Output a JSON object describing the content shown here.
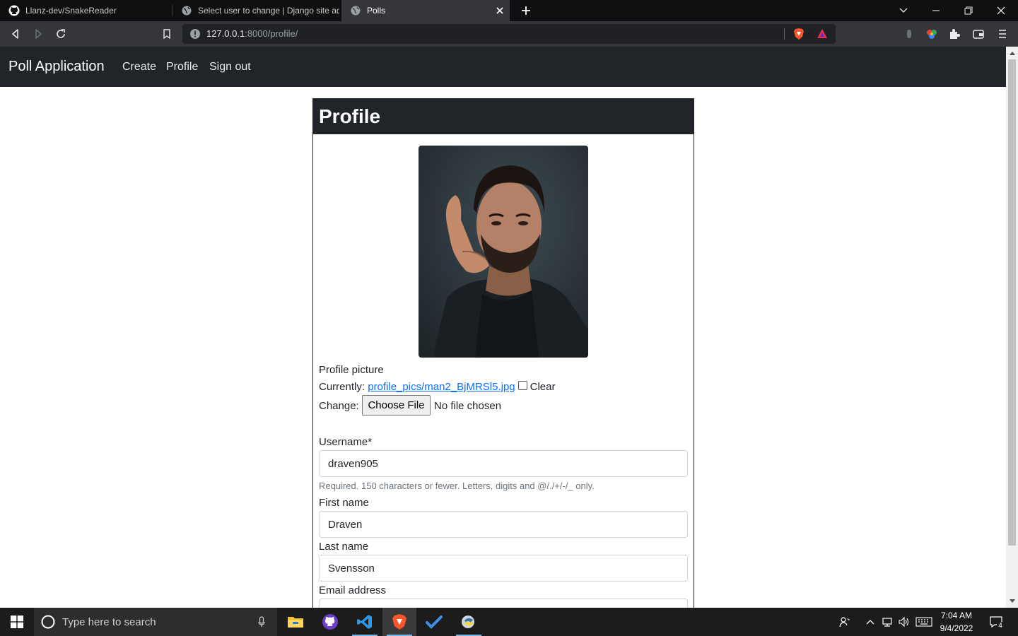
{
  "browser": {
    "tabs": [
      {
        "title": "Llanz-dev/SnakeReader",
        "icon": "github-icon"
      },
      {
        "title": "Select user to change | Django site admin",
        "icon": "globe-icon"
      },
      {
        "title": "Polls",
        "icon": "globe-icon",
        "active": true
      }
    ],
    "url_host": "127.0.0.1",
    "url_rest": ":8000/profile/"
  },
  "navbar": {
    "brand": "Poll Application",
    "links": [
      "Create",
      "Profile",
      "Sign out"
    ]
  },
  "profile": {
    "title": "Profile",
    "picture_label": "Profile picture",
    "currently_label": "Currently:",
    "current_file": "profile_pics/man2_BjMRSl5.jpg",
    "clear_label": "Clear",
    "change_label": "Change:",
    "choose_file_button": "Choose File",
    "no_file_text": "No file chosen",
    "username_label": "Username*",
    "username_value": "draven905",
    "username_help": "Required. 150 characters or fewer. Letters, digits and @/./+/-/_ only.",
    "first_name_label": "First name",
    "first_name_value": "Draven",
    "last_name_label": "Last name",
    "last_name_value": "Svensson",
    "email_label": "Email address"
  },
  "taskbar": {
    "search_placeholder": "Type here to search",
    "time": "7:04 AM",
    "date": "9/4/2022",
    "notification_count": "4"
  },
  "colors": {
    "navbar_bg": "#212529",
    "link": "#0d6efd"
  }
}
